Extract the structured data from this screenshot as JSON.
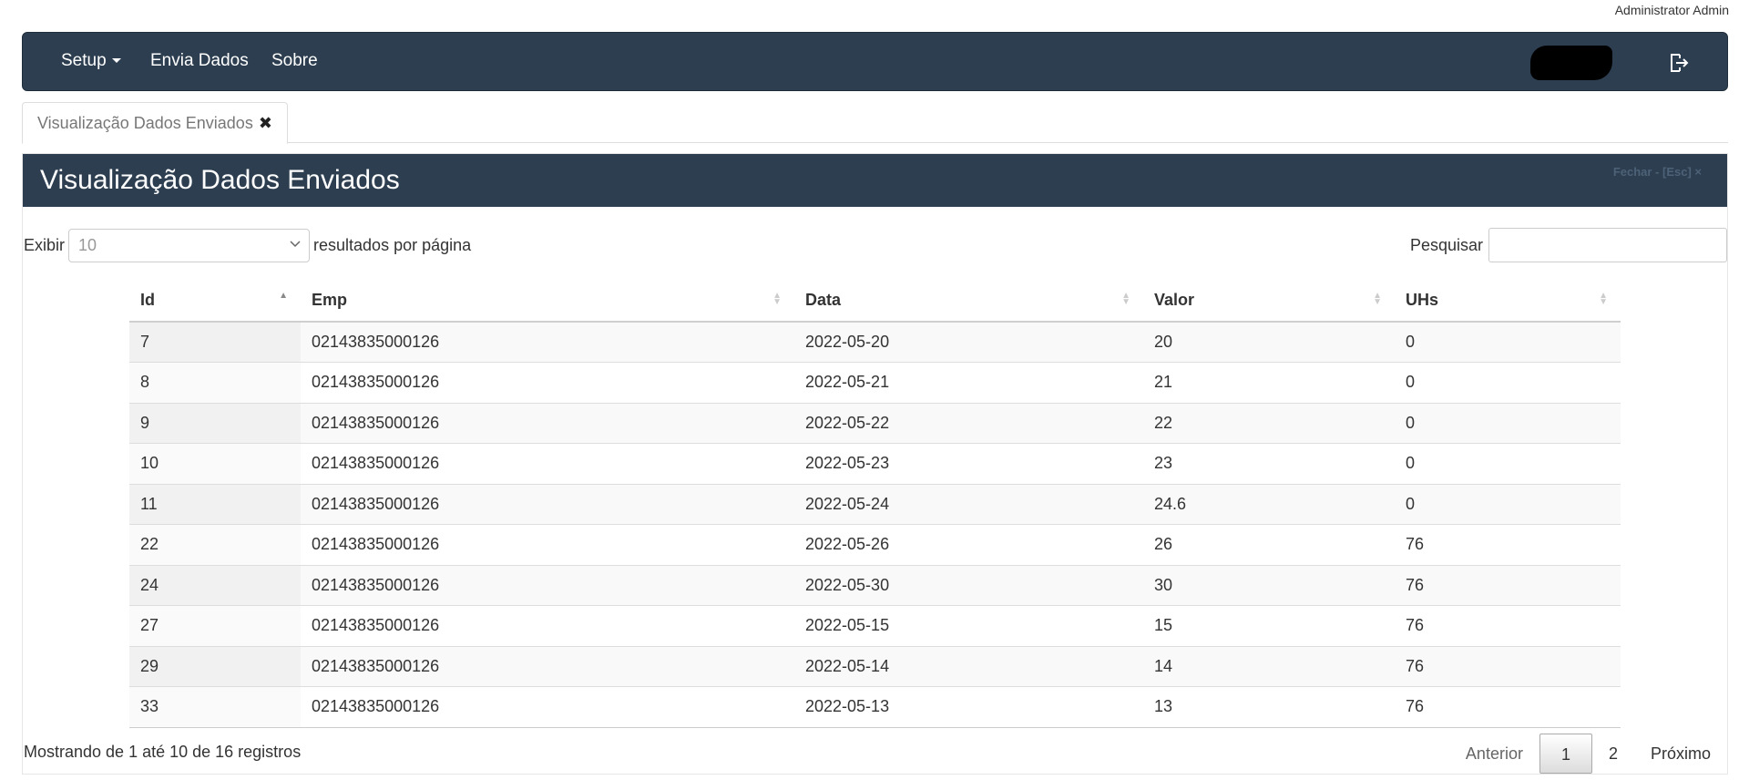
{
  "user": {
    "name": "Administrator Admin"
  },
  "nav": {
    "setup_label": "Setup",
    "envia_label": "Envia Dados",
    "sobre_label": "Sobre"
  },
  "tab": {
    "label": "Visualização Dados Enviados"
  },
  "panel": {
    "title": "Visualização Dados Enviados",
    "close_label": "Fechar - [Esc] ×"
  },
  "length": {
    "prefix": "Exibir",
    "selected": "10",
    "suffix": "resultados por página"
  },
  "search": {
    "label": "Pesquisar",
    "value": ""
  },
  "table": {
    "columns": [
      "Id",
      "Emp",
      "Data",
      "Valor",
      "UHs"
    ],
    "rows": [
      [
        "7",
        "02143835000126",
        "2022-05-20",
        "20",
        "0"
      ],
      [
        "8",
        "02143835000126",
        "2022-05-21",
        "21",
        "0"
      ],
      [
        "9",
        "02143835000126",
        "2022-05-22",
        "22",
        "0"
      ],
      [
        "10",
        "02143835000126",
        "2022-05-23",
        "23",
        "0"
      ],
      [
        "11",
        "02143835000126",
        "2022-05-24",
        "24.6",
        "0"
      ],
      [
        "22",
        "02143835000126",
        "2022-05-26",
        "26",
        "76"
      ],
      [
        "24",
        "02143835000126",
        "2022-05-30",
        "30",
        "76"
      ],
      [
        "27",
        "02143835000126",
        "2022-05-15",
        "15",
        "76"
      ],
      [
        "29",
        "02143835000126",
        "2022-05-14",
        "14",
        "76"
      ],
      [
        "33",
        "02143835000126",
        "2022-05-13",
        "13",
        "76"
      ]
    ]
  },
  "info": "Mostrando de 1 até 10 de 16 registros",
  "pagination": {
    "previous": "Anterior",
    "pages": [
      "1",
      "2"
    ],
    "next": "Próximo"
  },
  "colors": {
    "navbar": "#2c3e50",
    "accent": "#ffffff"
  },
  "icons": {
    "logout": "logout-icon",
    "tab_close": "close-icon",
    "select": "chevron-down-icon"
  }
}
